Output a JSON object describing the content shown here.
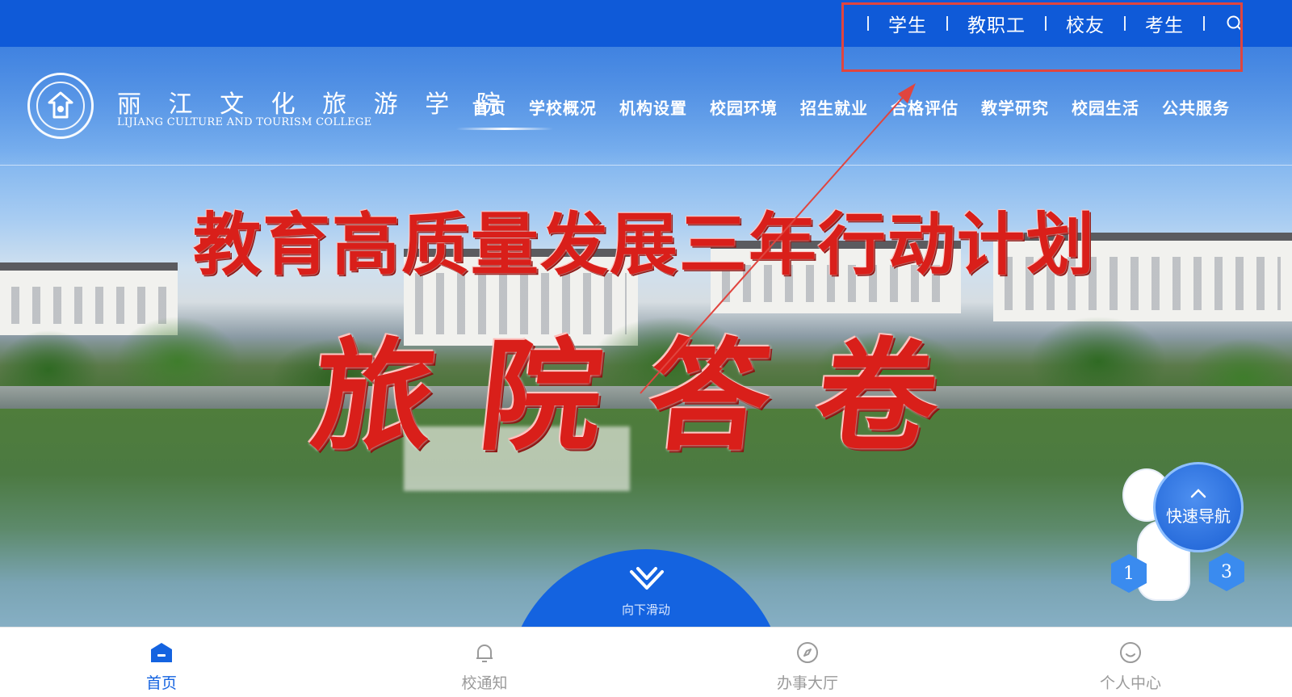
{
  "top_nav": {
    "links": [
      "学生",
      "教职工",
      "校友",
      "考生"
    ],
    "search_icon": "search-icon"
  },
  "header": {
    "school_name_cn": "丽 江 文 化 旅 游 学 院",
    "school_name_en": "LIJIANG CULTURE AND TOURISM COLLEGE",
    "nav": [
      "首页",
      "学校概况",
      "机构设置",
      "校园环境",
      "招生就业",
      "合格评估",
      "教学研究",
      "校园生活",
      "公共服务"
    ]
  },
  "banner": {
    "line1": "教育高质量发展三年行动计划",
    "line2": "旅院答卷"
  },
  "scroll": {
    "label": "向下滑动",
    "icon": "chevron-heart-icon"
  },
  "quick_nav": {
    "label": "快速导航",
    "pager": [
      "1",
      "3"
    ]
  },
  "tabbar": {
    "tabs": [
      {
        "label": "首页",
        "icon": "home-icon",
        "active": true
      },
      {
        "label": "校通知",
        "icon": "bell-icon",
        "active": false
      },
      {
        "label": "办事大厅",
        "icon": "compass-icon",
        "active": false
      },
      {
        "label": "个人中心",
        "icon": "smile-icon",
        "active": false
      }
    ]
  },
  "colors": {
    "primary_blue": "#0f5ad8",
    "banner_red": "#d91f1a",
    "annotation_red": "#e0453f"
  }
}
